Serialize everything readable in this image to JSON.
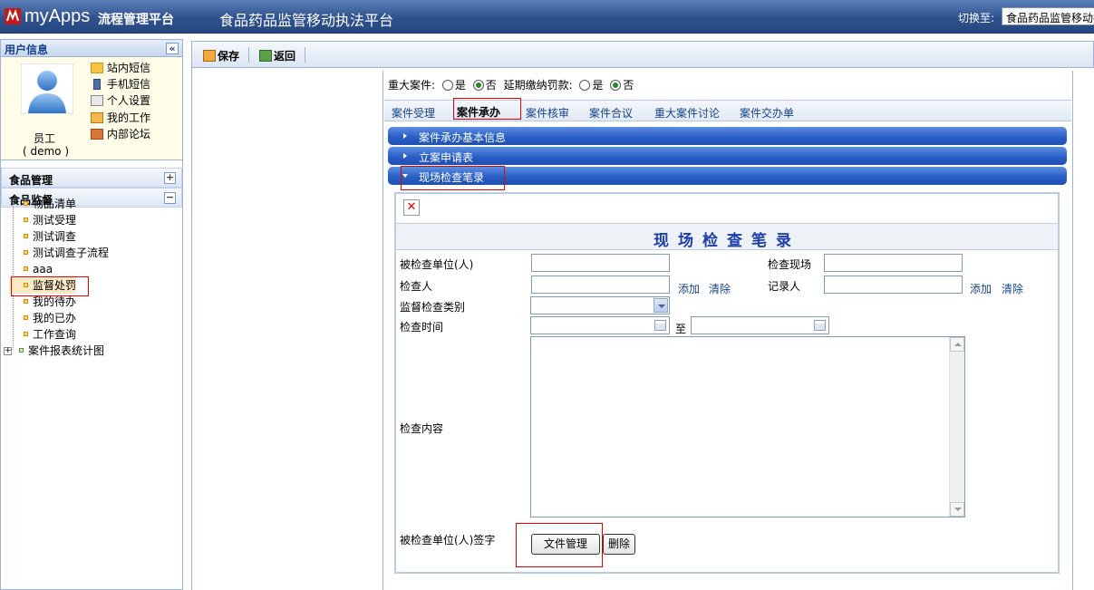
{
  "header": {
    "brand": "myApps",
    "brand_sub": "流程管理平台",
    "app_title": "食品药品监管移动执法平台",
    "switch_label": "切换至:",
    "switch_value": "食品药品监管移动执法平台"
  },
  "sidebar": {
    "user_panel_title": "用户信息",
    "user_role": "员工",
    "user_name": "( demo )",
    "quick_links": [
      {
        "label": "站内短信",
        "icon": "mail-icon"
      },
      {
        "label": "手机短信",
        "icon": "mobile-icon"
      },
      {
        "label": "个人设置",
        "icon": "settings-icon"
      },
      {
        "label": "我的工作",
        "icon": "work-icon"
      },
      {
        "label": "内部论坛",
        "icon": "forum-icon"
      }
    ],
    "categories": [
      {
        "label": "食品管理",
        "toggle": "+"
      },
      {
        "label": "食品监督",
        "toggle": "−"
      }
    ],
    "tree_items": [
      "物品清单",
      "测试受理",
      "测试调查",
      "测试调查子流程",
      "aaa",
      "监督处罚",
      "我的待办",
      "我的已办",
      "工作查询",
      "案件报表统计图"
    ],
    "active_item": "监督处罚"
  },
  "toolbar": {
    "save_label": "保存",
    "back_label": "返回"
  },
  "flags": {
    "major_case_label": "重大案件:",
    "yes": "是",
    "no": "否",
    "delay_label": "延期缴纳罚款:",
    "major_case_value": "否",
    "delay_value": "否"
  },
  "tabs": [
    "案件受理",
    "案件承办",
    "案件核审",
    "案件合议",
    "重大案件讨论",
    "案件交办单"
  ],
  "active_tab": "案件承办",
  "sections": [
    {
      "label": "案件承办基本信息",
      "expanded": false
    },
    {
      "label": "立案申请表",
      "expanded": false
    },
    {
      "label": "现场检查笔录",
      "expanded": true
    }
  ],
  "form": {
    "title": "现场检查笔录",
    "inspected_unit_label": "被检查单位(人)",
    "inspect_site_label": "检查现场",
    "inspector_label": "检查人",
    "recorder_label": "记录人",
    "add_label": "添加",
    "clear_label": "清除",
    "category_label": "监督检查类别",
    "time_label": "检查时间",
    "time_to": "至",
    "content_label": "检查内容",
    "signature_label": "被检查单位(人)签字",
    "file_button": "文件管理",
    "delete_button": "删除"
  },
  "colors": {
    "header": "#2f528e",
    "section_bar": "#2a5fc6",
    "highlight_box": "#ee0000",
    "form_title": "#1d3fa8"
  }
}
